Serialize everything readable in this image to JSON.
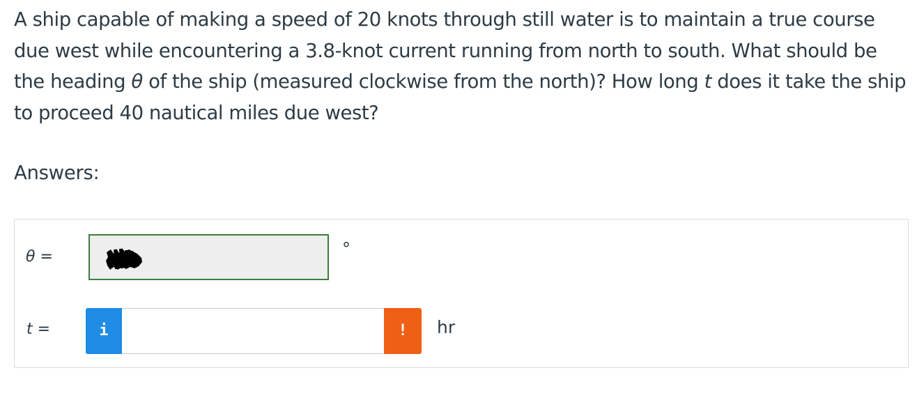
{
  "question": {
    "part1": "A ship capable of making a speed of 20 knots through still water is to maintain a true course due west while encountering a 3.8-knot current running from north to south. What should be the heading ",
    "theta_symbol": "θ",
    "part2": " of the ship (measured clockwise from the north)? How long ",
    "t_symbol": "t",
    "part3": " does it take the ship to proceed 40 nautical miles due west?"
  },
  "answers_label": "Answers:",
  "rows": {
    "theta": {
      "symbol": "θ",
      "equals": " =",
      "value_redacted": true,
      "unit": "°"
    },
    "t": {
      "symbol": "t",
      "equals": " =",
      "info_button_label": "i",
      "value": "",
      "warning_button_label": "!",
      "unit": "hr"
    }
  },
  "colors": {
    "text": "#2d3b45",
    "correct_border": "#3b7d3b",
    "info_blue": "#1f8ce6",
    "warning_orange": "#ef6016",
    "box_border": "#d9dcde"
  }
}
